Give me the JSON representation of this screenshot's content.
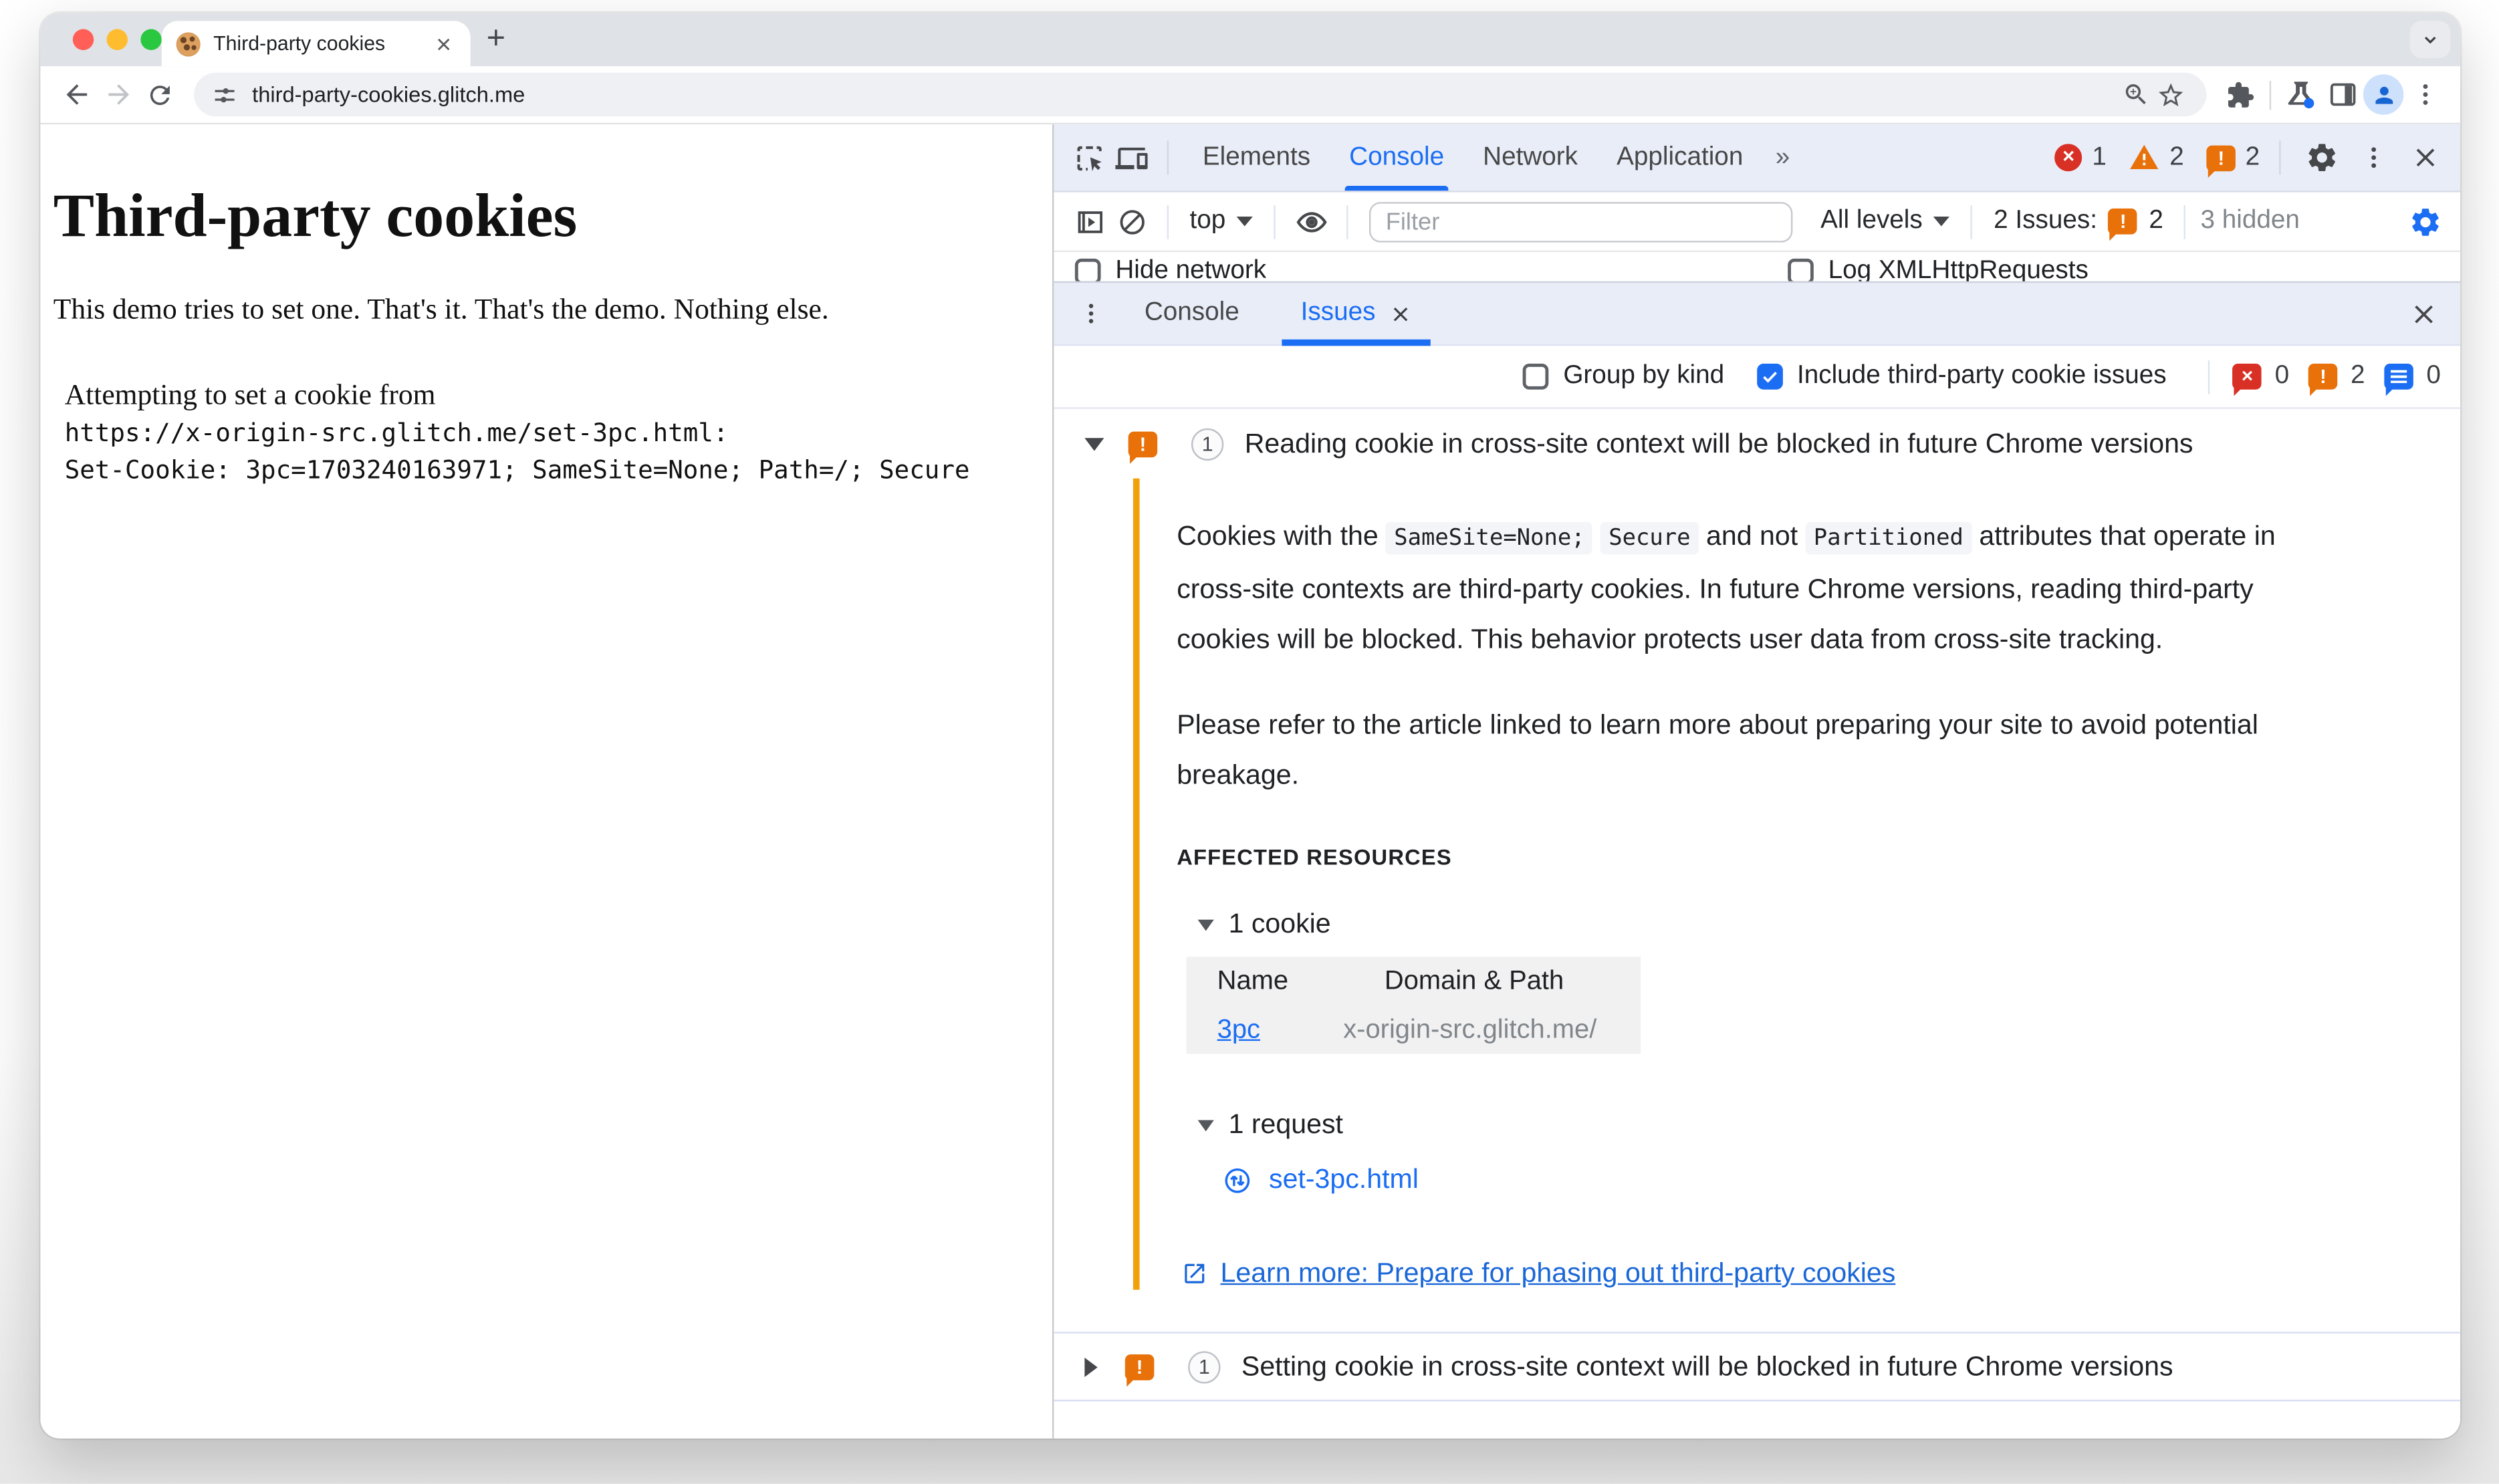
{
  "colors": {
    "accent": "#1b6ef3",
    "issue_orange": "#e8710a",
    "issue_bar_orange": "#efa00b",
    "error_red": "#d93025",
    "devtools_toolbar_bg": "#e9edf8"
  },
  "browser": {
    "tab_title": "Third-party cookies",
    "new_tab_button": "+",
    "url": "third-party-cookies.glitch.me"
  },
  "page": {
    "heading": "Third-party cookies",
    "intro": "This demo tries to set one. That's it. That's the demo. Nothing else.",
    "attempt_line": "Attempting to set a cookie from",
    "attempt_url": "https://x-origin-src.glitch.me/set-3pc.html:",
    "set_cookie_line": "Set-Cookie: 3pc=1703240163971; SameSite=None; Path=/; Secure"
  },
  "devtools": {
    "main_tabs": {
      "elements": "Elements",
      "console": "Console",
      "network": "Network",
      "application": "Application"
    },
    "overflow_label": "»",
    "error_count": "1",
    "warning_count": "2",
    "issue_badge_count": "2",
    "console_toolbar": {
      "context": "top",
      "filter_placeholder": "Filter",
      "level_filter": "All levels",
      "issues_label": "2 Issues:",
      "issues_count": "2",
      "hidden_label": "3 hidden"
    },
    "console_settings": {
      "hide_network": "Hide network",
      "log_xhr": "Log XMLHttpRequests"
    },
    "drawer": {
      "console_tab": "Console",
      "issues_tab": "Issues"
    },
    "issues_toolbar": {
      "group_by_kind": "Group by kind",
      "include_third_party": "Include third-party cookie issues",
      "page_error_count": "0",
      "breaking_change_count": "2",
      "improvement_count": "0"
    },
    "issue1": {
      "count": "1",
      "title": "Reading cookie in cross-site context will be blocked in future Chrome versions",
      "desc": {
        "t1": "Cookies with the ",
        "code1": "SameSite=None;",
        "t2": " ",
        "code2": "Secure",
        "t3": " and not ",
        "code3": "Partitioned",
        "t4": " attributes that operate in cross-site contexts are third-party cookies. In future Chrome versions, reading third-party cookies will be blocked. This behavior protects user data from cross-site tracking."
      },
      "desc2": "Please refer to the article linked to learn more about preparing your site to avoid potential breakage.",
      "affected_resources": "AFFECTED RESOURCES",
      "cookie_group": "1 cookie",
      "table": {
        "col_name": "Name",
        "col_domain": "Domain & Path",
        "row": {
          "name": "3pc",
          "domain": "x-origin-src.glitch.me/"
        }
      },
      "request_group": "1 request",
      "request_file": "set-3pc.html",
      "learn_more": "Learn more: Prepare for phasing out third-party cookies"
    },
    "issue2": {
      "count": "1",
      "title": "Setting cookie in cross-site context will be blocked in future Chrome versions"
    }
  }
}
